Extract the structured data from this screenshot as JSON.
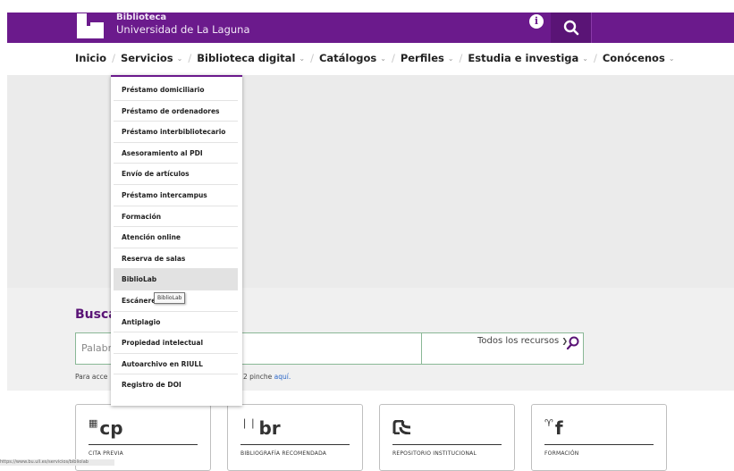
{
  "brand": {
    "line1": "Biblioteca",
    "line2": "Universidad de La Laguna"
  },
  "topbar_icons": [
    "info-icon",
    "search-icon"
  ],
  "nav": {
    "items": [
      {
        "label": "Inicio",
        "has_dropdown": false
      },
      {
        "label": "Servicios",
        "has_dropdown": true
      },
      {
        "label": "Biblioteca digital",
        "has_dropdown": true
      },
      {
        "label": "Catálogos",
        "has_dropdown": true
      },
      {
        "label": "Perfiles",
        "has_dropdown": true
      },
      {
        "label": "Estudia e investiga",
        "has_dropdown": true
      },
      {
        "label": "Conócenos",
        "has_dropdown": true
      }
    ]
  },
  "dropdown": {
    "items": [
      "Préstamo domiciliario",
      "Préstamo de ordenadores",
      "Préstamo interbibliotecario",
      "Asesoramiento al PDI",
      "Envío de artículos",
      "Préstamo intercampus",
      "Formación",
      "Atención online",
      "Reserva de salas",
      "BiblioLab",
      "Escáneres",
      "Antiplagio",
      "Propiedad intelectual",
      "Autoarchivo en RIULL",
      "Registro de DOI"
    ],
    "hovered": "BiblioLab",
    "tooltip": "BiblioLab"
  },
  "search": {
    "title": "Busca",
    "placeholder": "Palabr",
    "select_value": "Todos los recursos",
    "access_prefix": "Para acce",
    "access_suffix": "2 pinche ",
    "access_link": "aquí."
  },
  "cards": [
    {
      "abbr": "cp",
      "caption": "CITA PREVIA"
    },
    {
      "abbr": "br",
      "caption": "BIBLIOGRAFÍA RECOMENDADA"
    },
    {
      "abbr": "rc",
      "caption": "REPOSITORIO INSTITUCIONAL"
    },
    {
      "abbr": "f",
      "caption": "FORMACIÓN"
    }
  ],
  "status_url": "https://www.bu.ull.es/servicios/bibliolab"
}
